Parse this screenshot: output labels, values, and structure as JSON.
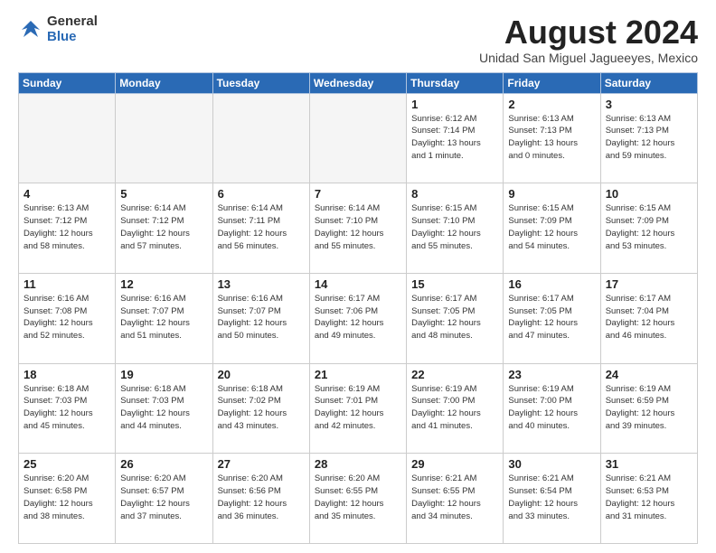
{
  "logo": {
    "general": "General",
    "blue": "Blue"
  },
  "title": "August 2024",
  "subtitle": "Unidad San Miguel Jagueeyes, Mexico",
  "days_of_week": [
    "Sunday",
    "Monday",
    "Tuesday",
    "Wednesday",
    "Thursday",
    "Friday",
    "Saturday"
  ],
  "weeks": [
    [
      {
        "day": "",
        "info": ""
      },
      {
        "day": "",
        "info": ""
      },
      {
        "day": "",
        "info": ""
      },
      {
        "day": "",
        "info": ""
      },
      {
        "day": "1",
        "info": "Sunrise: 6:12 AM\nSunset: 7:14 PM\nDaylight: 13 hours\nand 1 minute."
      },
      {
        "day": "2",
        "info": "Sunrise: 6:13 AM\nSunset: 7:13 PM\nDaylight: 13 hours\nand 0 minutes."
      },
      {
        "day": "3",
        "info": "Sunrise: 6:13 AM\nSunset: 7:13 PM\nDaylight: 12 hours\nand 59 minutes."
      }
    ],
    [
      {
        "day": "4",
        "info": "Sunrise: 6:13 AM\nSunset: 7:12 PM\nDaylight: 12 hours\nand 58 minutes."
      },
      {
        "day": "5",
        "info": "Sunrise: 6:14 AM\nSunset: 7:12 PM\nDaylight: 12 hours\nand 57 minutes."
      },
      {
        "day": "6",
        "info": "Sunrise: 6:14 AM\nSunset: 7:11 PM\nDaylight: 12 hours\nand 56 minutes."
      },
      {
        "day": "7",
        "info": "Sunrise: 6:14 AM\nSunset: 7:10 PM\nDaylight: 12 hours\nand 55 minutes."
      },
      {
        "day": "8",
        "info": "Sunrise: 6:15 AM\nSunset: 7:10 PM\nDaylight: 12 hours\nand 55 minutes."
      },
      {
        "day": "9",
        "info": "Sunrise: 6:15 AM\nSunset: 7:09 PM\nDaylight: 12 hours\nand 54 minutes."
      },
      {
        "day": "10",
        "info": "Sunrise: 6:15 AM\nSunset: 7:09 PM\nDaylight: 12 hours\nand 53 minutes."
      }
    ],
    [
      {
        "day": "11",
        "info": "Sunrise: 6:16 AM\nSunset: 7:08 PM\nDaylight: 12 hours\nand 52 minutes."
      },
      {
        "day": "12",
        "info": "Sunrise: 6:16 AM\nSunset: 7:07 PM\nDaylight: 12 hours\nand 51 minutes."
      },
      {
        "day": "13",
        "info": "Sunrise: 6:16 AM\nSunset: 7:07 PM\nDaylight: 12 hours\nand 50 minutes."
      },
      {
        "day": "14",
        "info": "Sunrise: 6:17 AM\nSunset: 7:06 PM\nDaylight: 12 hours\nand 49 minutes."
      },
      {
        "day": "15",
        "info": "Sunrise: 6:17 AM\nSunset: 7:05 PM\nDaylight: 12 hours\nand 48 minutes."
      },
      {
        "day": "16",
        "info": "Sunrise: 6:17 AM\nSunset: 7:05 PM\nDaylight: 12 hours\nand 47 minutes."
      },
      {
        "day": "17",
        "info": "Sunrise: 6:17 AM\nSunset: 7:04 PM\nDaylight: 12 hours\nand 46 minutes."
      }
    ],
    [
      {
        "day": "18",
        "info": "Sunrise: 6:18 AM\nSunset: 7:03 PM\nDaylight: 12 hours\nand 45 minutes."
      },
      {
        "day": "19",
        "info": "Sunrise: 6:18 AM\nSunset: 7:03 PM\nDaylight: 12 hours\nand 44 minutes."
      },
      {
        "day": "20",
        "info": "Sunrise: 6:18 AM\nSunset: 7:02 PM\nDaylight: 12 hours\nand 43 minutes."
      },
      {
        "day": "21",
        "info": "Sunrise: 6:19 AM\nSunset: 7:01 PM\nDaylight: 12 hours\nand 42 minutes."
      },
      {
        "day": "22",
        "info": "Sunrise: 6:19 AM\nSunset: 7:00 PM\nDaylight: 12 hours\nand 41 minutes."
      },
      {
        "day": "23",
        "info": "Sunrise: 6:19 AM\nSunset: 7:00 PM\nDaylight: 12 hours\nand 40 minutes."
      },
      {
        "day": "24",
        "info": "Sunrise: 6:19 AM\nSunset: 6:59 PM\nDaylight: 12 hours\nand 39 minutes."
      }
    ],
    [
      {
        "day": "25",
        "info": "Sunrise: 6:20 AM\nSunset: 6:58 PM\nDaylight: 12 hours\nand 38 minutes."
      },
      {
        "day": "26",
        "info": "Sunrise: 6:20 AM\nSunset: 6:57 PM\nDaylight: 12 hours\nand 37 minutes."
      },
      {
        "day": "27",
        "info": "Sunrise: 6:20 AM\nSunset: 6:56 PM\nDaylight: 12 hours\nand 36 minutes."
      },
      {
        "day": "28",
        "info": "Sunrise: 6:20 AM\nSunset: 6:55 PM\nDaylight: 12 hours\nand 35 minutes."
      },
      {
        "day": "29",
        "info": "Sunrise: 6:21 AM\nSunset: 6:55 PM\nDaylight: 12 hours\nand 34 minutes."
      },
      {
        "day": "30",
        "info": "Sunrise: 6:21 AM\nSunset: 6:54 PM\nDaylight: 12 hours\nand 33 minutes."
      },
      {
        "day": "31",
        "info": "Sunrise: 6:21 AM\nSunset: 6:53 PM\nDaylight: 12 hours\nand 31 minutes."
      }
    ]
  ]
}
